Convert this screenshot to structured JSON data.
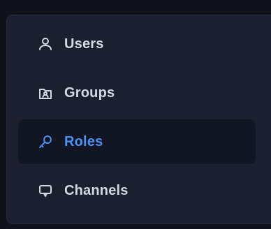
{
  "sidebar": {
    "items": [
      {
        "label": "Users",
        "icon": "user-icon",
        "active": false
      },
      {
        "label": "Groups",
        "icon": "group-icon",
        "active": false
      },
      {
        "label": "Roles",
        "icon": "key-icon",
        "active": true
      },
      {
        "label": "Channels",
        "icon": "chat-icon",
        "active": false
      }
    ]
  },
  "colors": {
    "background": "#0f111b",
    "panel": "#1b1f30",
    "active_bg": "#121522",
    "text": "#d4d8e4",
    "accent": "#4d8ff7"
  }
}
